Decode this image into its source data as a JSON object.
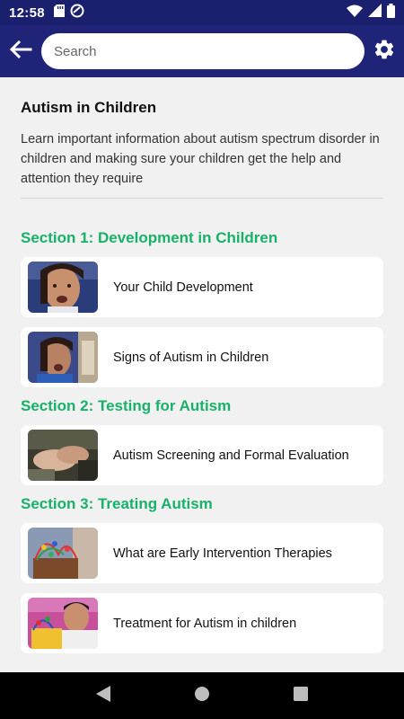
{
  "status_bar": {
    "time": "12:58"
  },
  "search": {
    "placeholder": "Search"
  },
  "page": {
    "title": "Autism in Children",
    "description": "Learn important information about autism spectrum disorder in children and making sure your children get the help and attention they require"
  },
  "sections": [
    {
      "title": "Section 1: Development in Children",
      "items": [
        "Your Child Development",
        "Signs of Autism in Children"
      ]
    },
    {
      "title": "Section 2: Testing for Autism",
      "items": [
        "Autism Screening and Formal Evaluation"
      ]
    },
    {
      "title": "Section 3: Treating Autism",
      "items": [
        "What are Early Intervention Therapies",
        "Treatment for Autism in children"
      ]
    }
  ],
  "colors": {
    "app_bar": "#1f2478",
    "section_title": "#17b26a",
    "background": "#f1f1f1"
  },
  "icons": [
    "back-arrow-icon",
    "gear-icon",
    "wifi-icon",
    "signal-icon",
    "battery-icon",
    "sd-card-icon",
    "at-sign-icon",
    "nav-back-icon",
    "nav-home-icon",
    "nav-recents-icon"
  ]
}
